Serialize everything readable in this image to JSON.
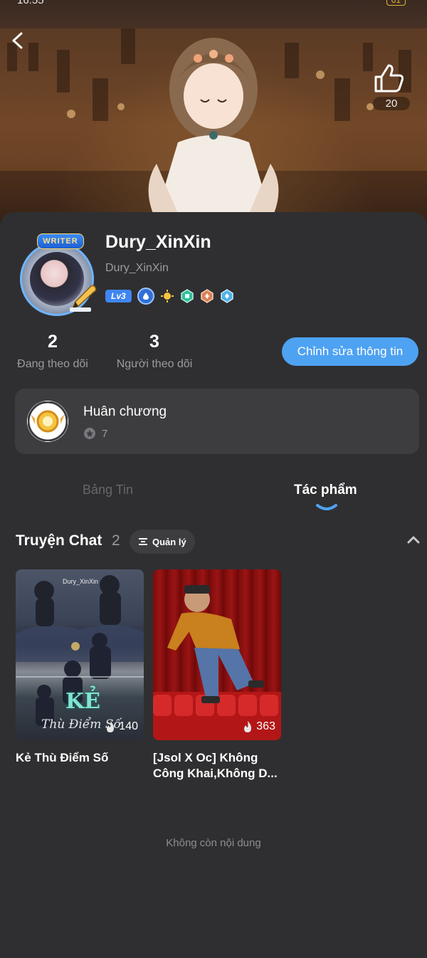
{
  "status_bar": {
    "time": "16:55",
    "battery": "61"
  },
  "header": {
    "like_count": "20"
  },
  "profile": {
    "writer_tag": "WRITER",
    "username": "Dury_XinXin",
    "handle": "Dury_XinXin",
    "level": "Lv3"
  },
  "stats": {
    "following_count": "2",
    "following_label": "Đang theo dõi",
    "followers_count": "3",
    "followers_label": "Người theo dõi",
    "edit_button": "Chỉnh sửa thông tin"
  },
  "medals": {
    "title": "Huân chương",
    "count": "7"
  },
  "tabs": {
    "news": "Bảng Tin",
    "works": "Tác phẩm"
  },
  "section": {
    "title": "Truyện Chat",
    "count": "2",
    "manage_label": "Quản lý"
  },
  "stories": [
    {
      "title": "Kẻ Thù Điểm Số",
      "heat": "140",
      "cover_watermark": "Dury_XinXin",
      "cover_title": "KẺ",
      "cover_subtitle": "Thù Điểm Số"
    },
    {
      "title": "[Jsol X Oc] Không Công Khai,Không D...",
      "heat": "363"
    }
  ],
  "footer": {
    "end_text": "Không còn nội dung"
  },
  "colors": {
    "background": "#2f2f31",
    "card": "#3d3d40",
    "accent": "#4ea2f2",
    "muted_text": "#9a9aa0"
  }
}
